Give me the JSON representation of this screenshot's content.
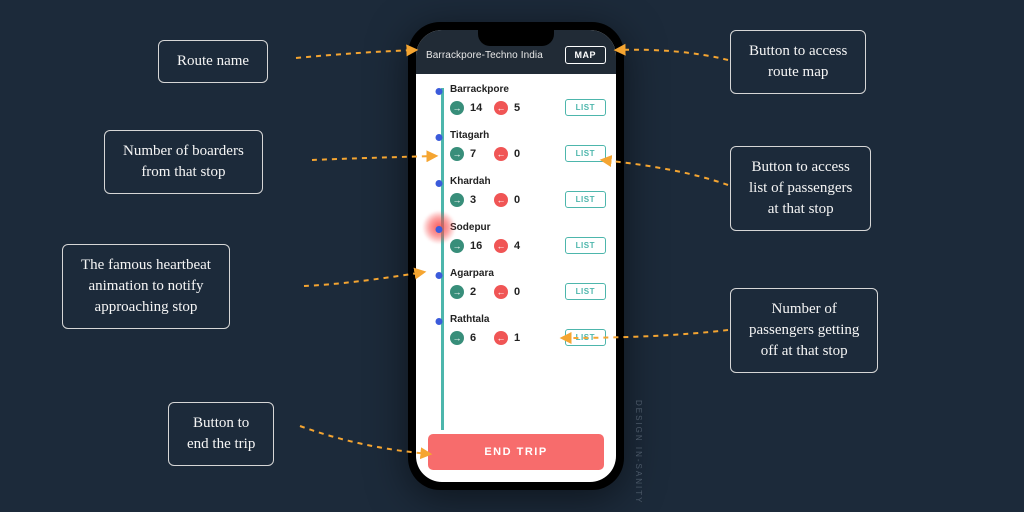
{
  "header": {
    "route_name": "Barrackpore-Techno India",
    "map_btn": "MAP"
  },
  "stops": [
    {
      "name": "Barrackpore",
      "boarders": 14,
      "alighters": 5,
      "list": "LIST",
      "pulse": false
    },
    {
      "name": "Titagarh",
      "boarders": 7,
      "alighters": 0,
      "list": "LIST",
      "pulse": false
    },
    {
      "name": "Khardah",
      "boarders": 3,
      "alighters": 0,
      "list": "LIST",
      "pulse": false
    },
    {
      "name": "Sodepur",
      "boarders": 16,
      "alighters": 4,
      "list": "LIST",
      "pulse": true
    },
    {
      "name": "Agarpara",
      "boarders": 2,
      "alighters": 0,
      "list": "LIST",
      "pulse": false
    },
    {
      "name": "Rathtala",
      "boarders": 6,
      "alighters": 1,
      "list": "LIST",
      "pulse": false
    }
  ],
  "end_trip_label": "END TRIP",
  "annotations": {
    "route_name": "Route name",
    "boarders": "Number of boarders\nfrom that stop",
    "heartbeat": "The famous heartbeat\nanimation to notify\napproaching stop",
    "end_trip": "Button to\nend the trip",
    "map_btn": "Button to access\nroute map",
    "list_btn": "Button to access\nlist of passengers\nat that stop",
    "alighters": "Number of\npassengers getting\noff at that stop"
  },
  "watermark": "DESIGN IN-SANITY",
  "colors": {
    "bg": "#1c2a3a",
    "accent_teal": "#4db6ac",
    "accent_red": "#f76c6c",
    "chip_red": "#f05555",
    "chip_green": "#388e7a",
    "arrow": "#f5a531"
  }
}
